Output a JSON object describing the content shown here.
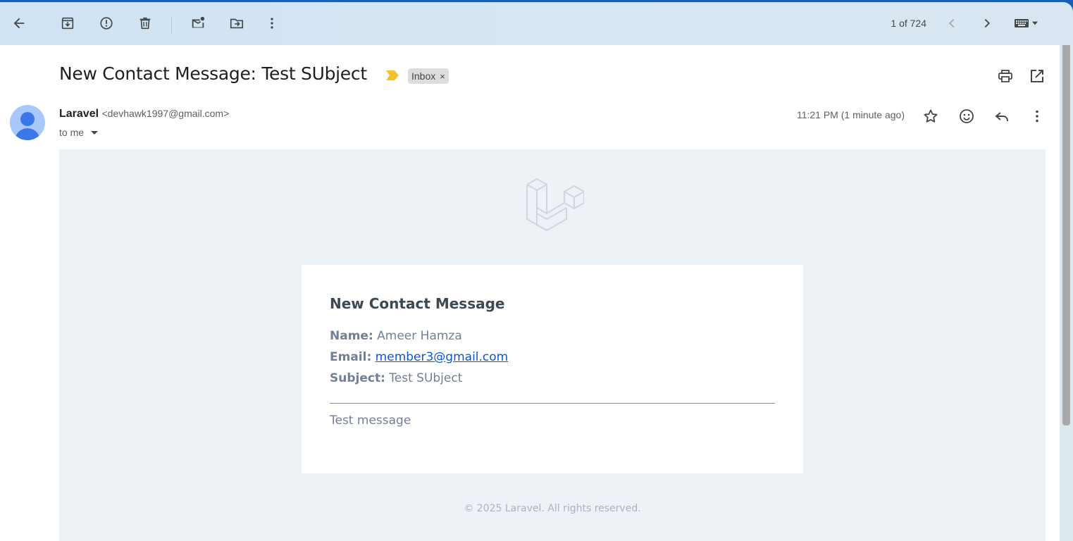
{
  "toolbar": {
    "pager_text": "1 of 724"
  },
  "email": {
    "subject": "New Contact Message: Test SUbject",
    "label": "Inbox",
    "label_remove": "×",
    "sender_name": "Laravel",
    "sender_email": "<devhawk1997@gmail.com>",
    "recipient": "to me",
    "time": "11:21 PM (1 minute ago)"
  },
  "body": {
    "card_title": "New Contact Message",
    "name_label": "Name:",
    "name_value": "Ameer Hamza",
    "email_label": "Email:",
    "email_value": "member3@gmail.com",
    "subject_label": "Subject:",
    "subject_value": "Test SUbject",
    "message": "Test message",
    "footer": "© 2025 Laravel. All rights reserved."
  },
  "colors": {
    "importance_marker": "#f2c12e",
    "link": "#0b57d0",
    "email_bg": "#edf2f7"
  }
}
